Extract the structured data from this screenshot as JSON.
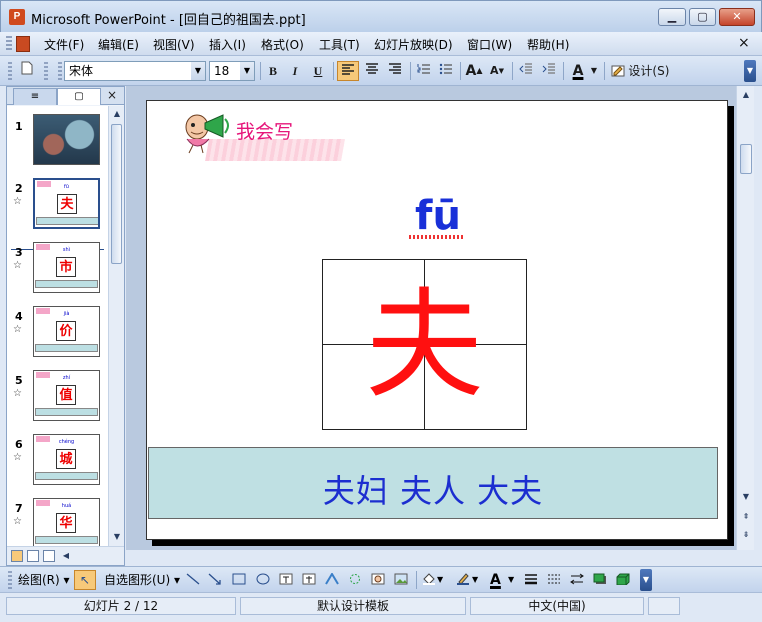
{
  "window": {
    "title": "Microsoft PowerPoint - [回自己的祖国去.ppt]",
    "app_icon": "P"
  },
  "menu": {
    "items": [
      "文件(F)",
      "编辑(E)",
      "视图(V)",
      "插入(I)",
      "格式(O)",
      "工具(T)",
      "幻灯片放映(D)",
      "窗口(W)",
      "帮助(H)"
    ],
    "close_glyph": "×"
  },
  "toolbar": {
    "font": "宋体",
    "size": "18",
    "bold": "B",
    "italic": "I",
    "underline": "U",
    "grow_font": "A",
    "shrink_font": "A",
    "font_color": "A",
    "design_label": "设计(S)"
  },
  "left_pane": {
    "tab_outline": "≡",
    "tab_slides": "▢",
    "close": "×",
    "slides": [
      {
        "num": "1",
        "char": "",
        "pinyin": ""
      },
      {
        "num": "2",
        "char": "夫",
        "pinyin": "fū"
      },
      {
        "num": "3",
        "char": "市",
        "pinyin": "shì"
      },
      {
        "num": "4",
        "char": "价",
        "pinyin": "jià"
      },
      {
        "num": "5",
        "char": "值",
        "pinyin": "zhí"
      },
      {
        "num": "6",
        "char": "城",
        "pinyin": "chéng"
      },
      {
        "num": "7",
        "char": "华",
        "pinyin": "huá"
      }
    ]
  },
  "slide": {
    "heading": "我会写",
    "pinyin": "fū",
    "character": "夫",
    "words": "夫妇  夫人  大夫"
  },
  "drawbar": {
    "draw_label": "绘图(R)",
    "autoshapes_label": "自选图形(U)"
  },
  "status": {
    "slide_pos": "幻灯片 2 / 12",
    "template": "默认设计模板",
    "language": "中文(中国)"
  },
  "colors": {
    "accent": "#2a4f8d",
    "highlight": "#f7c97a",
    "slide_char": "#ff1010",
    "slide_pinyin": "#1930d8",
    "slide_band": "#bfe0e3",
    "heading_pink": "#e6157a"
  }
}
